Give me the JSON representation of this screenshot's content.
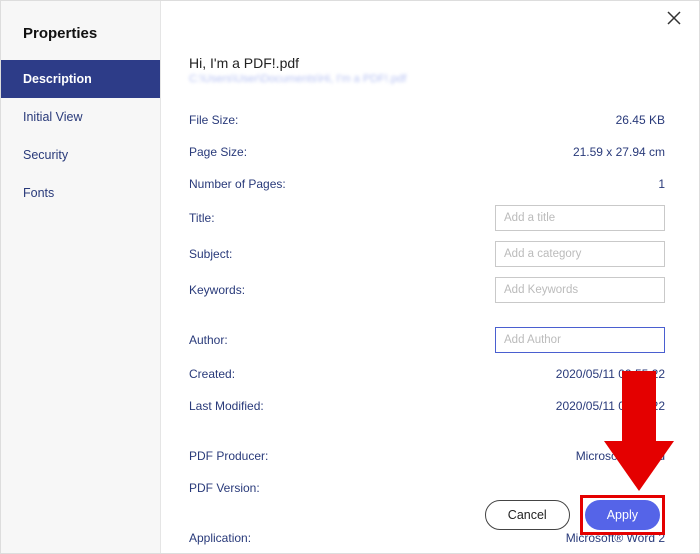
{
  "sidebar": {
    "title": "Properties",
    "items": [
      {
        "label": "Description",
        "active": true
      },
      {
        "label": "Initial View",
        "active": false
      },
      {
        "label": "Security",
        "active": false
      },
      {
        "label": "Fonts",
        "active": false
      }
    ]
  },
  "header": {
    "doc_title": "Hi, I'm a PDF!.pdf",
    "doc_path": "C:\\Users\\User\\Documents\\Hi, I'm a PDF!.pdf"
  },
  "props": {
    "file_size_label": "File Size:",
    "file_size_value": "26.45 KB",
    "page_size_label": "Page Size:",
    "page_size_value": "21.59 x 27.94 cm",
    "num_pages_label": "Number of Pages:",
    "num_pages_value": "1",
    "title_label": "Title:",
    "title_placeholder": "Add a title",
    "subject_label": "Subject:",
    "subject_placeholder": "Add a category",
    "keywords_label": "Keywords:",
    "keywords_placeholder": "Add Keywords",
    "author_label": "Author:",
    "author_placeholder": "Add Author",
    "created_label": "Created:",
    "created_value": "2020/05/11 09:55:22",
    "modified_label": "Last Modified:",
    "modified_value": "2020/05/11 09:55:22",
    "producer_label": "PDF Producer:",
    "producer_value": "Microsoft® Word",
    "version_label": "PDF Version:",
    "version_value": "",
    "application_label": "Application:",
    "application_value": "Microsoft® Word 2"
  },
  "footer": {
    "cancel": "Cancel",
    "apply": "Apply"
  }
}
